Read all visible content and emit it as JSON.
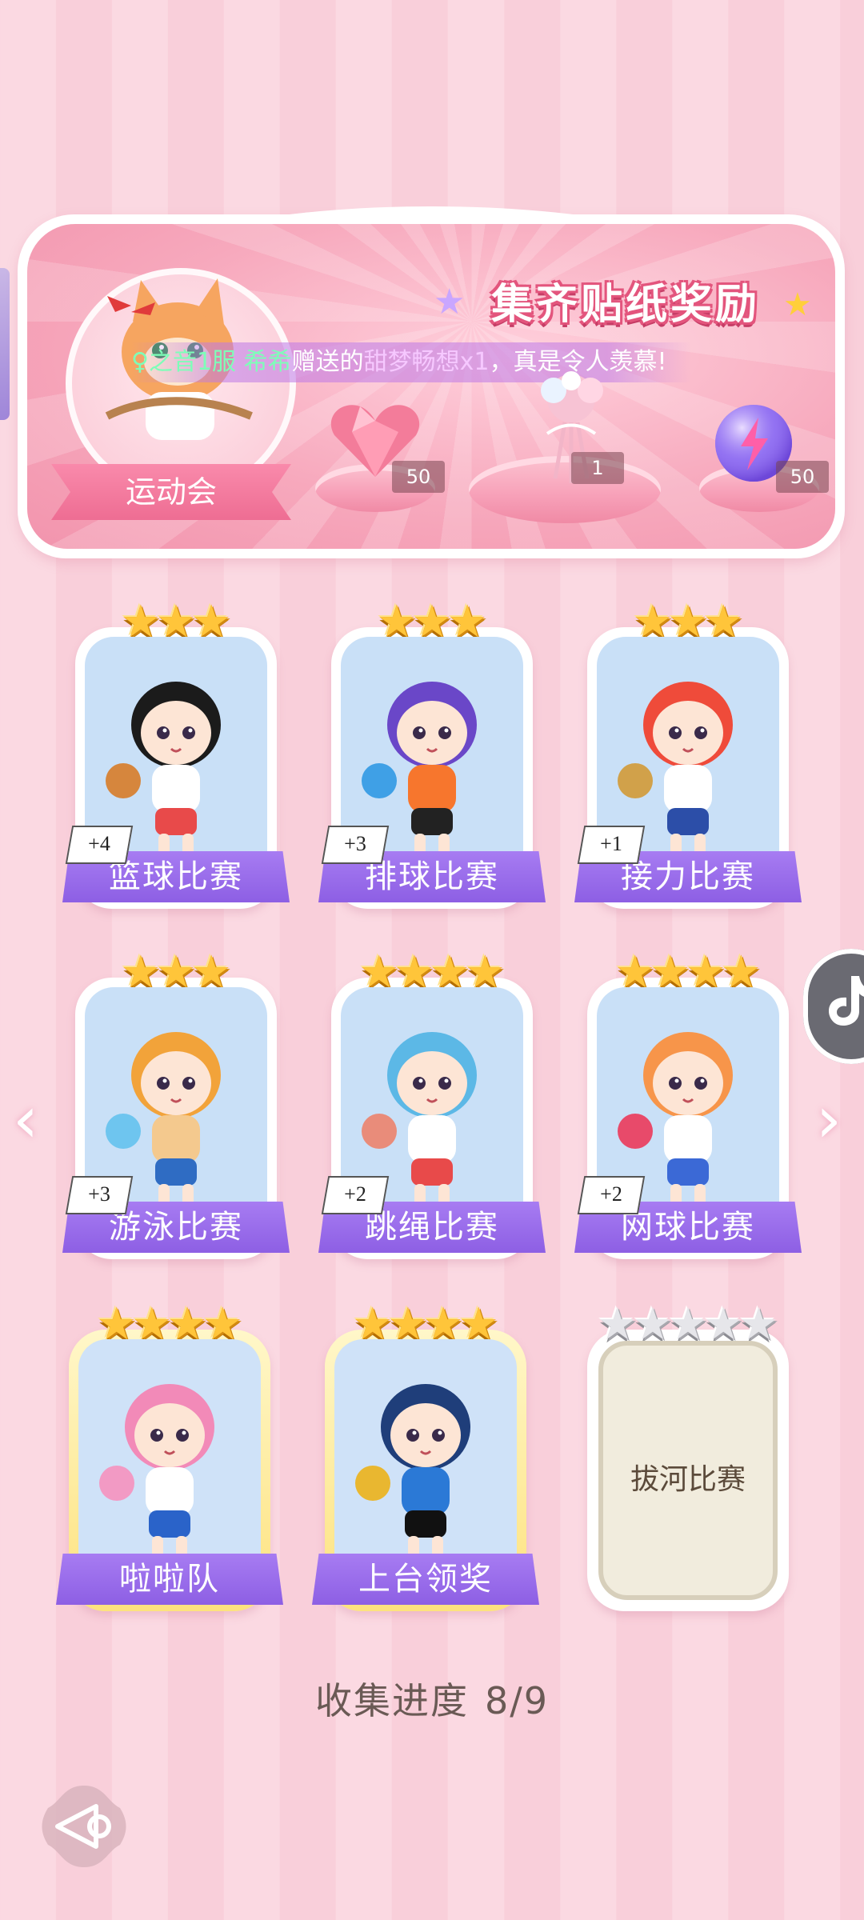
{
  "banner": {
    "title": "集齐贴纸奖励",
    "ticker_prefix": "♀之音1服 希希",
    "ticker_mid": "赠送的",
    "ticker_item": "甜梦畅想x1",
    "ticker_suffix": "，真是令人羡慕!",
    "event_label": "运动会",
    "rewards": [
      {
        "name": "heart-gem",
        "count": "50"
      },
      {
        "name": "bouquet",
        "count": "1"
      },
      {
        "name": "energy-orb",
        "count": "50"
      }
    ]
  },
  "cards": [
    {
      "label": "篮球比赛",
      "bonus": "+4",
      "stars": 3,
      "filled": 3
    },
    {
      "label": "排球比赛",
      "bonus": "+3",
      "stars": 3,
      "filled": 3
    },
    {
      "label": "接力比赛",
      "bonus": "+1",
      "stars": 3,
      "filled": 3
    },
    {
      "label": "游泳比赛",
      "bonus": "+3",
      "stars": 3,
      "filled": 3
    },
    {
      "label": "跳绳比赛",
      "bonus": "+2",
      "stars": 4,
      "filled": 4
    },
    {
      "label": "网球比赛",
      "bonus": "+2",
      "stars": 4,
      "filled": 4
    },
    {
      "label": "啦啦队",
      "bonus": "",
      "stars": 4,
      "filled": 4
    },
    {
      "label": "上台领奖",
      "bonus": "",
      "stars": 4,
      "filled": 4
    },
    {
      "label": "拔河比赛",
      "bonus": "",
      "stars": 5,
      "filled": 0,
      "locked": true
    }
  ],
  "progress": {
    "label": "收集进度",
    "value": "8/9"
  },
  "nav": {
    "prev_icon": "chevron-left-icon",
    "next_icon": "chevron-right-icon"
  },
  "colors": {
    "accent_purple": "#8d5fe4",
    "star_gold": "#ffc53a",
    "banner_pink": "#f7a9bd"
  }
}
